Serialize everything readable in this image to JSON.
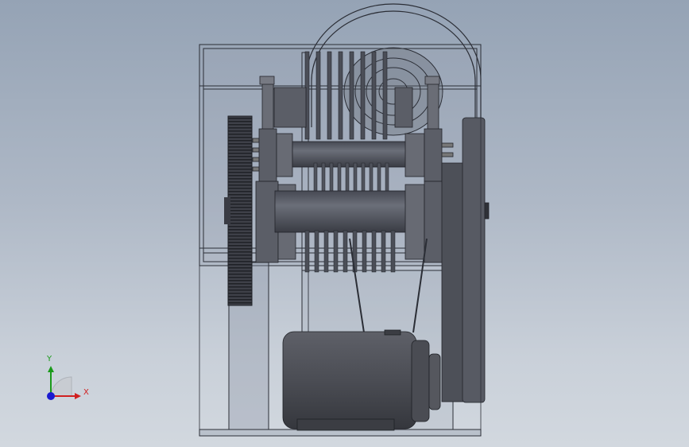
{
  "viewport": {
    "background_top": "#95a3b5",
    "background_bottom": "#d2d8df"
  },
  "triad": {
    "x_label": "X",
    "y_label": "Y",
    "x_color": "#d02020",
    "y_color": "#1a9a1a",
    "z_color": "#1a1ad0"
  },
  "model": {
    "steel_dark": "#3d3f47",
    "steel_mid": "#5a5d66",
    "steel_light": "#7a7e88",
    "glass_line": "#2b2e36"
  }
}
